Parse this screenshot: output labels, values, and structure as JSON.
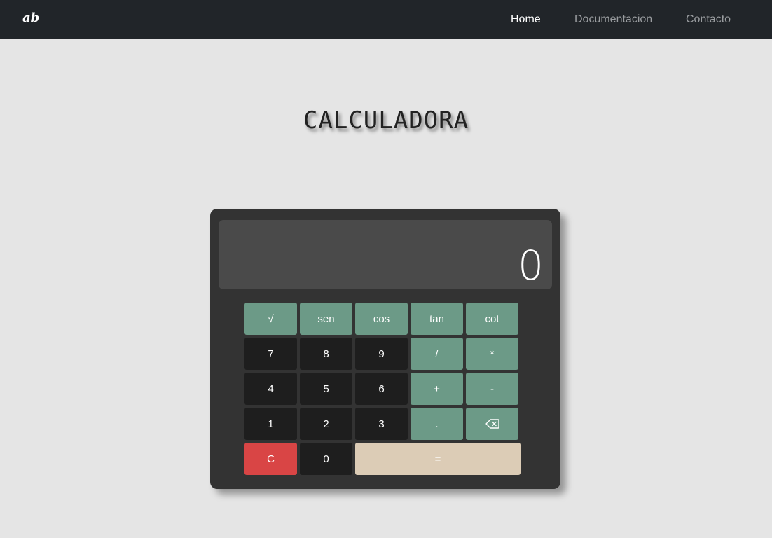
{
  "navbar": {
    "brand": "ab",
    "links": [
      {
        "label": "Home",
        "active": true
      },
      {
        "label": "Documentacion",
        "active": false
      },
      {
        "label": "Contacto",
        "active": false
      }
    ]
  },
  "title": "CALCULADORA",
  "calculator": {
    "display": "0",
    "keys": {
      "sqrt": "√",
      "sen": "sen",
      "cos": "cos",
      "tan": "tan",
      "cot": "cot",
      "seven": "7",
      "eight": "8",
      "nine": "9",
      "divide": "/",
      "multiply": "*",
      "four": "4",
      "five": "5",
      "six": "6",
      "plus": "+",
      "minus": "-",
      "one": "1",
      "two": "2",
      "three": "3",
      "dot": ".",
      "clear": "C",
      "zero": "0",
      "equals": "="
    },
    "backspace_icon": "backspace-icon"
  },
  "colors": {
    "operator": "#6c9a87",
    "digit": "#1e1e1e",
    "clear": "#d94545",
    "equals": "#dcccb6",
    "body": "#333333",
    "display": "#4a4a4a"
  }
}
